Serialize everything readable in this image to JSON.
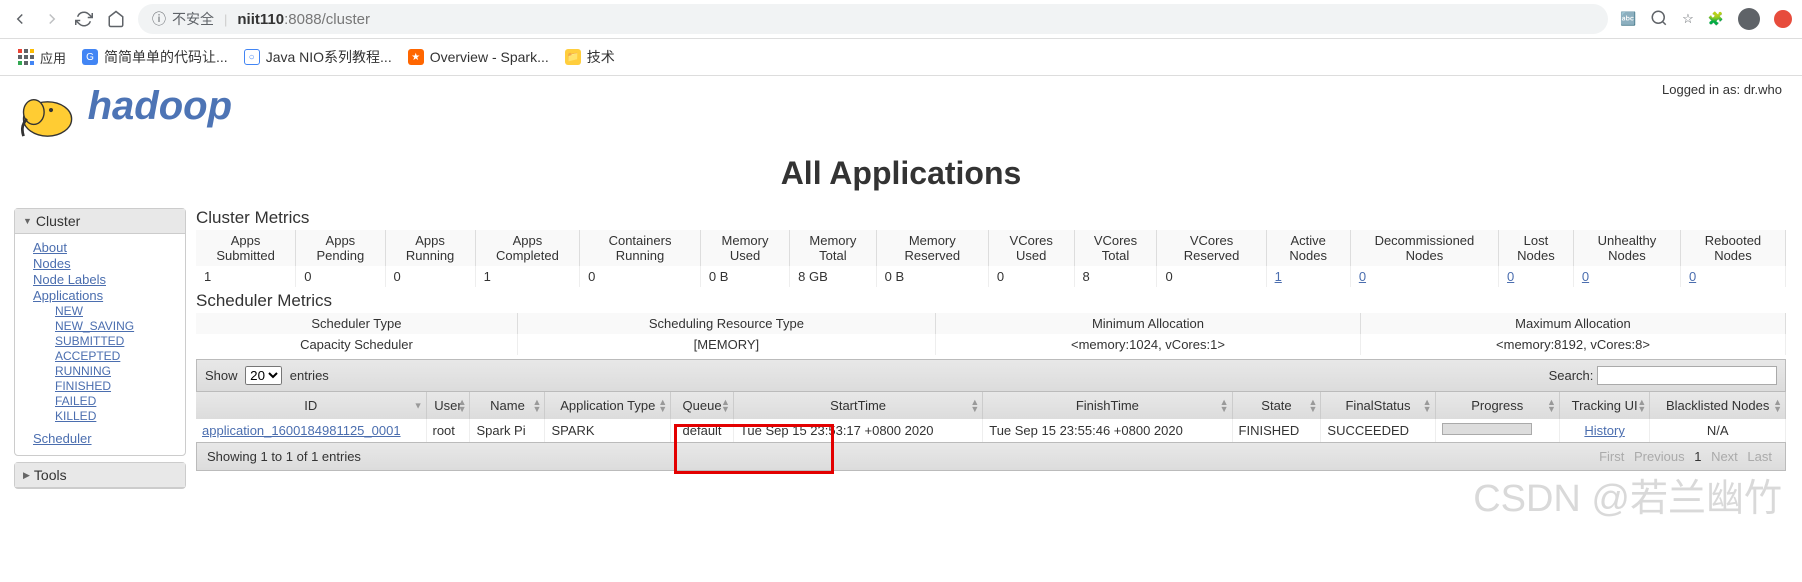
{
  "browser": {
    "url_warn": "不安全",
    "url_host": "niit110",
    "url_path": ":8088/cluster"
  },
  "bookmarks": {
    "apps": "应用",
    "b1": "简简单单的代码让...",
    "b2": "Java NIO系列教程...",
    "b3": "Overview - Spark...",
    "b4": "技术"
  },
  "status": "Logged in as: dr.who",
  "title": "All Applications",
  "logo": "hadoop",
  "sidebar": {
    "cluster_head": "Cluster",
    "about": "About",
    "nodes": "Nodes",
    "node_labels": "Node Labels",
    "applications": "Applications",
    "new": "NEW",
    "new_saving": "NEW_SAVING",
    "submitted": "SUBMITTED",
    "accepted": "ACCEPTED",
    "running": "RUNNING",
    "finished": "FINISHED",
    "failed": "FAILED",
    "killed": "KILLED",
    "scheduler": "Scheduler",
    "tools_head": "Tools"
  },
  "cluster_metrics": {
    "heading": "Cluster Metrics",
    "headers": [
      "Apps Submitted",
      "Apps Pending",
      "Apps Running",
      "Apps Completed",
      "Containers Running",
      "Memory Used",
      "Memory Total",
      "Memory Reserved",
      "VCores Used",
      "VCores Total",
      "VCores Reserved",
      "Active Nodes",
      "Decommissioned Nodes",
      "Lost Nodes",
      "Unhealthy Nodes",
      "Rebooted Nodes"
    ],
    "row": [
      "1",
      "0",
      "0",
      "1",
      "0",
      "0 B",
      "8 GB",
      "0 B",
      "0",
      "8",
      "0",
      "1",
      "0",
      "0",
      "0",
      "0"
    ]
  },
  "sched_metrics": {
    "heading": "Scheduler Metrics",
    "headers": [
      "Scheduler Type",
      "Scheduling Resource Type",
      "Minimum Allocation",
      "Maximum Allocation"
    ],
    "row": [
      "Capacity Scheduler",
      "[MEMORY]",
      "<memory:1024, vCores:1>",
      "<memory:8192, vCores:8>"
    ]
  },
  "controls": {
    "show": "Show",
    "entries": "entries",
    "select_val": "20",
    "search": "Search:"
  },
  "app_table": {
    "headers": [
      "ID",
      "User",
      "Name",
      "Application Type",
      "Queue",
      "StartTime",
      "FinishTime",
      "State",
      "FinalStatus",
      "Progress",
      "Tracking UI",
      "Blacklisted Nodes"
    ],
    "row": {
      "id": "application_1600184981125_0001",
      "user": "root",
      "name": "Spark Pi",
      "type": "SPARK",
      "queue": "default",
      "start": "Tue Sep 15 23:53:17 +0800 2020",
      "finish": "Tue Sep 15 23:55:46 +0800 2020",
      "state": "FINISHED",
      "final": "SUCCEEDED",
      "tracking": "History",
      "blacklisted": "N/A"
    }
  },
  "footer": {
    "showing": "Showing 1 to 1 of 1 entries",
    "first": "First",
    "prev": "Previous",
    "page": "1",
    "next": "Next",
    "last": "Last"
  },
  "watermark": "CSDN @若兰幽竹"
}
